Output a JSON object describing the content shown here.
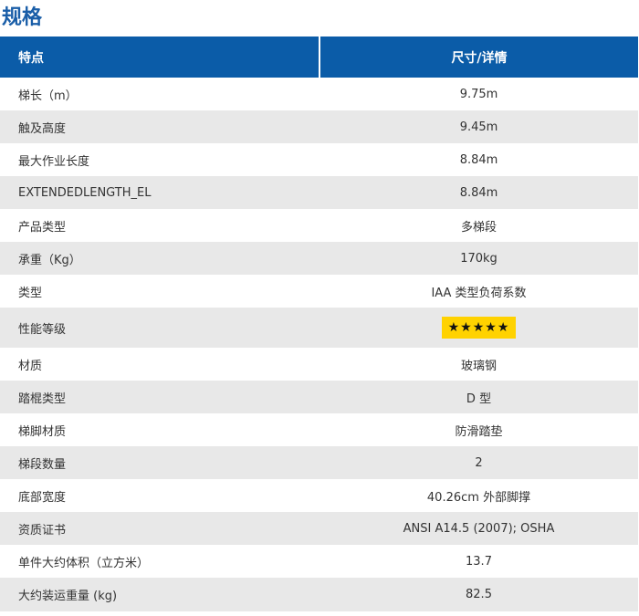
{
  "title": "规格",
  "table": {
    "headers": [
      "特点",
      "尺寸/详情"
    ],
    "rows": [
      {
        "label": "梯长（m）",
        "value": "9.75m"
      },
      {
        "label": "触及高度",
        "value": "9.45m"
      },
      {
        "label": "最大作业长度",
        "value": "8.84m"
      },
      {
        "label": "EXTENDEDLENGTH_EL",
        "value": "8.84m"
      },
      {
        "label": "产品类型",
        "value": "多梯段"
      },
      {
        "label": "承重（Kg）",
        "value": "170kg"
      },
      {
        "label": "类型",
        "value": "IAA 类型负荷系数"
      },
      {
        "label": "性能等级",
        "value": "★★★★★",
        "rating": 5,
        "badge_color": "#ffd200"
      },
      {
        "label": "材质",
        "value": "玻璃钢"
      },
      {
        "label": "踏棍类型",
        "value": "D 型"
      },
      {
        "label": "梯脚材质",
        "value": "防滑踏垫"
      },
      {
        "label": "梯段数量",
        "value": "2"
      },
      {
        "label": "底部宽度",
        "value": "40.26cm 外部脚撑"
      },
      {
        "label": "资质证书",
        "value": "ANSI A14.5 (2007); OSHA"
      },
      {
        "label": "单件大约体积（立方米）",
        "value": "13.7"
      },
      {
        "label": "大约装运重量 (kg)",
        "value": "82.5"
      }
    ]
  },
  "colors": {
    "title": "#1a5ea8",
    "header_bg": "#0b5ca8",
    "stripe": "#e8e8e8",
    "star_badge": "#ffd200"
  }
}
